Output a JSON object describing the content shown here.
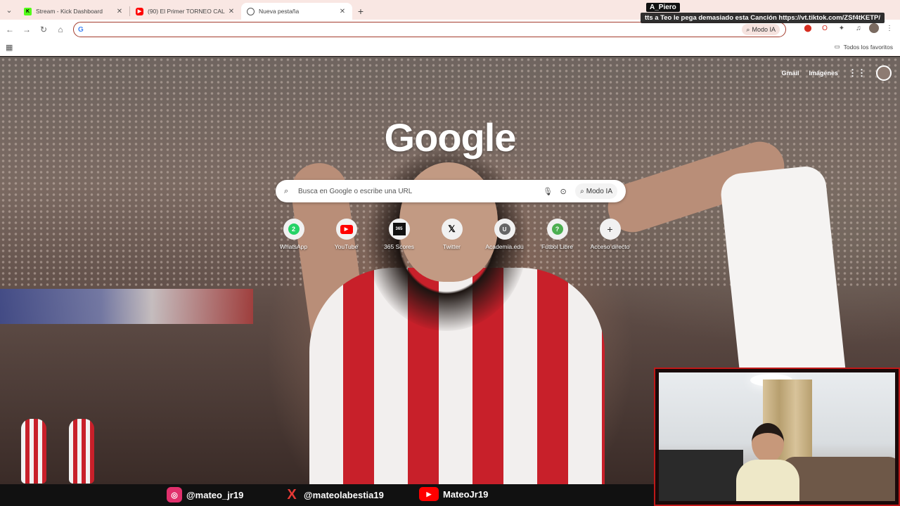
{
  "browser": {
    "tabs": [
      {
        "label": "Stream - Kick Dashboard",
        "favicon": "kick-icon",
        "active": false
      },
      {
        "label": "(90) El Primer TORNEO CAL",
        "favicon": "youtube-icon",
        "active": false
      },
      {
        "label": "Nueva pestaña",
        "favicon": "google-icon",
        "active": true
      }
    ],
    "omnibox": {
      "value": "",
      "modo_ia": "Modo IA"
    },
    "bookmarks": {
      "all_favorites": "Todos los favoritos"
    }
  },
  "stream_overlay": {
    "username": "A_Piero",
    "message": "tts a Teo le pega demasiado esta Canción https://vt.tiktok.com/ZSf4tKETP/"
  },
  "newtab": {
    "logo": "Google",
    "top_links": {
      "gmail": "Gmail",
      "images": "Imágenes"
    },
    "search": {
      "placeholder": "Busca en Google o escribe una URL",
      "modo_ia": "Modo IA"
    },
    "shortcuts": [
      {
        "label": "WhatsApp",
        "icon": "whatsapp-icon",
        "glyph": "2"
      },
      {
        "label": "YouTube",
        "icon": "youtube-icon",
        "glyph": "▶"
      },
      {
        "label": "365 Scores",
        "icon": "365scores-icon",
        "glyph": "365"
      },
      {
        "label": "Twitter",
        "icon": "x-icon",
        "glyph": "𝕏"
      },
      {
        "label": "Academia.edu",
        "icon": "academia-icon",
        "glyph": "U"
      },
      {
        "label": "Futbol Libre",
        "icon": "question-icon",
        "glyph": "?"
      },
      {
        "label": "Acceso directo",
        "icon": "plus-icon",
        "glyph": "+"
      }
    ]
  },
  "social_bar": {
    "instagram": "@mateo_jr19",
    "x": "@mateolabestia19",
    "youtube": "MateoJr19"
  },
  "colors": {
    "omnibox_border": "#a33b2c",
    "tabstrip_bg": "#f9e7e3",
    "cam_border": "#c01818"
  }
}
